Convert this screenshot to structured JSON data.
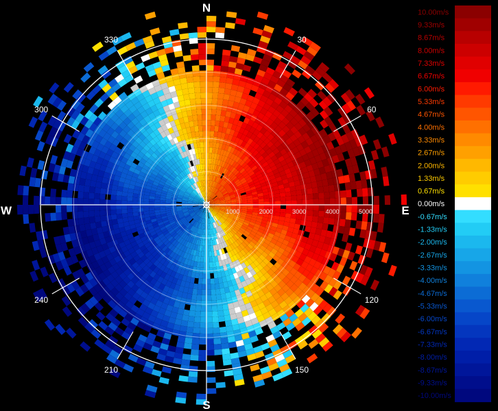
{
  "chart_data": {
    "type": "polar-heatmap",
    "description_units": "radial velocity m/s",
    "cardinals": {
      "north": "N",
      "east": "E",
      "south": "S",
      "west": "W"
    },
    "azimuth_labels": [
      {
        "az": 30,
        "text": "30"
      },
      {
        "az": 60,
        "text": "60"
      },
      {
        "az": 120,
        "text": "120"
      },
      {
        "az": 150,
        "text": "150"
      },
      {
        "az": 210,
        "text": "210"
      },
      {
        "az": 240,
        "text": "240"
      },
      {
        "az": 300,
        "text": "300"
      },
      {
        "az": 330,
        "text": "330"
      }
    ],
    "range_labels": [
      {
        "r": 1000,
        "text": "1000"
      },
      {
        "r": 2000,
        "text": "2000"
      },
      {
        "r": 3000,
        "text": "3000"
      },
      {
        "r": 4000,
        "text": "4000"
      },
      {
        "r": 5000,
        "text": "5000"
      }
    ],
    "range_max": 5000,
    "range_rings": [
      1000,
      2000,
      3000,
      4000,
      5000
    ],
    "outer_ring_range": 5000,
    "spoke_azimuths": [
      30,
      60,
      120,
      150,
      210,
      240,
      300,
      330
    ],
    "velocity_range": [
      -10,
      10
    ],
    "zero_line_azimuth": 337,
    "legend": {
      "entries": [
        {
          "label": "10.00m/s",
          "color": "#8b0000"
        },
        {
          "label": "9.33m/s",
          "color": "#a00000"
        },
        {
          "label": "8.67m/s",
          "color": "#b80000"
        },
        {
          "label": "8.00m/s",
          "color": "#cc0000"
        },
        {
          "label": "7.33m/s",
          "color": "#e00000"
        },
        {
          "label": "6.67m/s",
          "color": "#f00000"
        },
        {
          "label": "6.00m/s",
          "color": "#ff1a00"
        },
        {
          "label": "5.33m/s",
          "color": "#ff3a00"
        },
        {
          "label": "4.67m/s",
          "color": "#ff5500"
        },
        {
          "label": "4.00m/s",
          "color": "#ff7000"
        },
        {
          "label": "3.33m/s",
          "color": "#ff8a00"
        },
        {
          "label": "2.67m/s",
          "color": "#ffa000"
        },
        {
          "label": "2.00m/s",
          "color": "#ffb800"
        },
        {
          "label": "1.33m/s",
          "color": "#ffcc00"
        },
        {
          "label": "0.67m/s",
          "color": "#ffe000"
        },
        {
          "label": "0.00m/s",
          "color": "#ffffff"
        },
        {
          "label": "-0.67m/s",
          "color": "#33ddff"
        },
        {
          "label": "-1.33m/s",
          "color": "#22ccf5"
        },
        {
          "label": "-2.00m/s",
          "color": "#1bb8ee"
        },
        {
          "label": "-2.67m/s",
          "color": "#17a6e8"
        },
        {
          "label": "-3.33m/s",
          "color": "#1394e2"
        },
        {
          "label": "-4.00m/s",
          "color": "#1080dc"
        },
        {
          "label": "-4.67m/s",
          "color": "#0c6cd5"
        },
        {
          "label": "-5.33m/s",
          "color": "#0958cf"
        },
        {
          "label": "-6.00m/s",
          "color": "#0646c8"
        },
        {
          "label": "-6.67m/s",
          "color": "#0436be"
        },
        {
          "label": "-7.33m/s",
          "color": "#0228b4"
        },
        {
          "label": "-8.00m/s",
          "color": "#001ea8"
        },
        {
          "label": "-8.67m/s",
          "color": "#00169a"
        },
        {
          "label": "-9.33m/s",
          "color": "#000e8c"
        },
        {
          "label": "-10.00m/s",
          "color": "#00087e"
        }
      ]
    }
  }
}
